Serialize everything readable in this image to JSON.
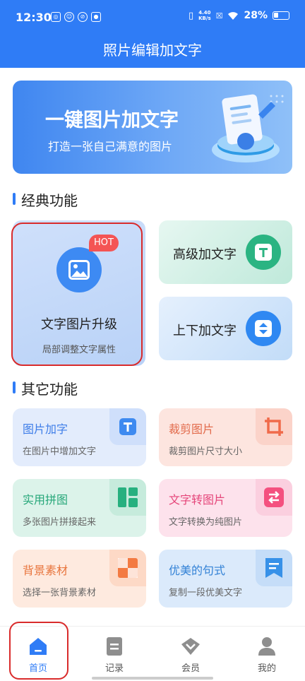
{
  "status_bar": {
    "time": "12:30",
    "speed_value": "4.40",
    "speed_unit": "KB/s",
    "battery": "28%"
  },
  "app_bar": {
    "title": "照片编辑加文字"
  },
  "banner": {
    "title": "一键图片加文字",
    "subtitle": "打造一张自己满意的图片"
  },
  "sections": {
    "classic": "经典功能",
    "other": "其它功能"
  },
  "classic": {
    "main": {
      "badge": "HOT",
      "title": "文字图片升级",
      "subtitle": "局部调整文字属性",
      "icon": "image-icon"
    },
    "advanced": {
      "title": "高级加文字",
      "icon": "text-t-icon",
      "color": "#2bb482"
    },
    "updown": {
      "title": "上下加文字",
      "icon": "vertical-arrows-icon",
      "color": "#2f88f2"
    }
  },
  "grid": [
    {
      "title": "图片加字",
      "subtitle": "在图片中增加文字",
      "title_color": "#3e7de8",
      "bg": "#e3ecfc",
      "icon_bg": "#cfdffb",
      "icon_color": "#3e8af0",
      "icon": "text-t-icon"
    },
    {
      "title": "裁剪图片",
      "subtitle": "裁剪图片尺寸大小",
      "title_color": "#e26b4c",
      "bg": "#fde5df",
      "icon_bg": "#fbd3c9",
      "icon_color": "#f06a4a",
      "icon": "crop-icon"
    },
    {
      "title": "实用拼图",
      "subtitle": "多张图片拼接起来",
      "title_color": "#26a779",
      "bg": "#dcf3ea",
      "icon_bg": "#c6ebdc",
      "icon_color": "#27b07f",
      "icon": "collage-icon"
    },
    {
      "title": "文字转图片",
      "subtitle": "文字转换为纯图片",
      "title_color": "#e5467a",
      "bg": "#fde2ec",
      "icon_bg": "#fbcfdf",
      "icon_color": "#f4507f",
      "icon": "convert-icon"
    },
    {
      "title": "背景素材",
      "subtitle": "选择一张背景素材",
      "title_color": "#e8753d",
      "bg": "#feeadf",
      "icon_bg": "#fdd9c6",
      "icon_color": "#f37a42",
      "icon": "background-icon"
    },
    {
      "title": "优美的句式",
      "subtitle": "复制一段优美文字",
      "title_color": "#3382d6",
      "bg": "#dbeafb",
      "icon_bg": "#c5ddf8",
      "icon_color": "#3791e8",
      "icon": "bookmark-icon"
    }
  ],
  "tabs": [
    {
      "label": "首页",
      "icon": "home-icon",
      "active": true
    },
    {
      "label": "记录",
      "icon": "record-icon",
      "active": false
    },
    {
      "label": "会员",
      "icon": "diamond-icon",
      "active": false
    },
    {
      "label": "我的",
      "icon": "user-icon",
      "active": false
    }
  ],
  "colors": {
    "primary": "#2f7cf6",
    "highlight_border": "#d92b2b",
    "hot_badge": "#f45454"
  }
}
